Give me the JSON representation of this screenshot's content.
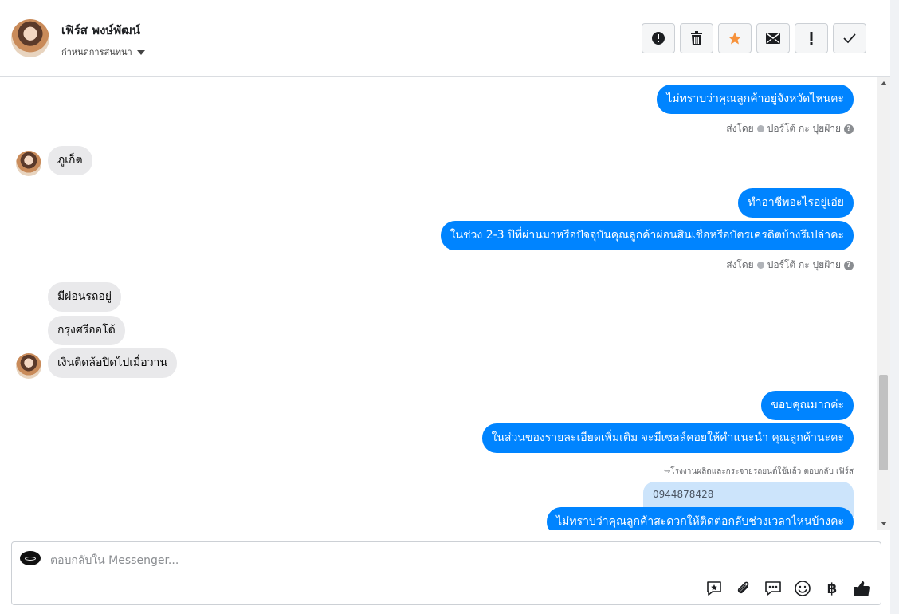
{
  "header": {
    "contact_name": "เฟิร์ส พงษ์พัฒน์",
    "assign_label": "กำหนดการสนทนา",
    "toolbar": [
      {
        "name": "mark-spam-button",
        "icon": "alert-circle-icon"
      },
      {
        "name": "delete-button",
        "icon": "trash-icon"
      },
      {
        "name": "star-button",
        "icon": "star-icon"
      },
      {
        "name": "mark-unread-button",
        "icon": "envelope-icon"
      },
      {
        "name": "mark-important-button",
        "icon": "exclamation-icon"
      },
      {
        "name": "mark-done-button",
        "icon": "check-icon"
      }
    ]
  },
  "messages": {
    "m1": "ไม่ทราบว่าคุณลูกค้าอยู่จังหวัดไหนคะ",
    "sentby1": "ส่งโดย",
    "sender1": "ปอร์โต้ กะ ปุยฝ้าย",
    "m2": "ภูเก็ต",
    "m3": "ทำอาชีพอะไรอยู่เอ่ย",
    "m4": "ในช่วง 2-3 ปีที่ผ่านมาหรือปัจจุบันคุณลูกค้าผ่อนสินเชื่อหรือบัตรเครดิตบ้างรึเปล่าคะ",
    "sentby2": "ส่งโดย",
    "sender2": "ปอร์โต้ กะ ปุยฝ้าย",
    "m5": "มีผ่อนรถอยู่",
    "m6": "กรุงศรีออโต้",
    "m7": "เงินติดล้อปิดไปเมื่อวาน",
    "m8": "ขอบคุณมากค่ะ",
    "m9": "ในส่วนของรายละเอียดเพิ่มเติม จะมีเซลล์คอยให้คำแนะนำ คุณลูกค้านะคะ",
    "reply_note": "↪โรงงานผลิตและกระจายรถยนต์ใช้แล้ว ตอบกลับ เฟิร์ส",
    "quoted": "0944878428",
    "m10": "ไม่ทราบว่าคุณลูกค้าสะดวกให้ติดต่อกลับช่วงเวลาไหนบ้างคะ"
  },
  "composer": {
    "placeholder": "ตอบกลับใน Messenger...",
    "tools": [
      "saved-reply-icon",
      "attach-icon",
      "chat-icon",
      "emoji-icon",
      "baht-icon",
      "like-icon"
    ],
    "baht": "฿"
  },
  "colors": {
    "outgoing": "#0084ff",
    "incoming": "#e9e9eb",
    "star": "#f7923b"
  }
}
